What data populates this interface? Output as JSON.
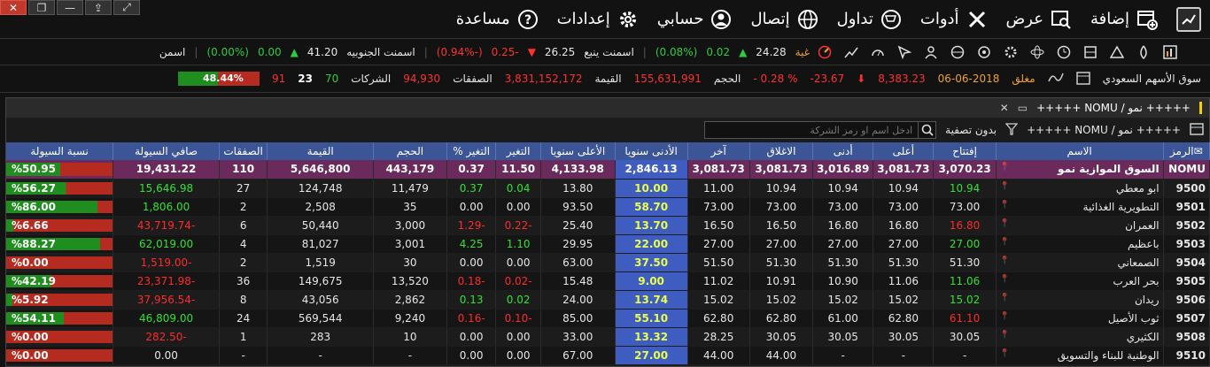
{
  "window_controls": {
    "close": "✕",
    "restore": "❐",
    "minimize": "—",
    "pin": "⇪",
    "expand": "⤢"
  },
  "menu": [
    {
      "label": "",
      "icon": "chart-icon"
    },
    {
      "label": "إضافة",
      "icon": "add-window-icon"
    },
    {
      "label": "عرض",
      "icon": "view-icon"
    },
    {
      "label": "أدوات",
      "icon": "tools-icon"
    },
    {
      "label": "تداول",
      "icon": "cart-icon"
    },
    {
      "label": "إتصال",
      "icon": "globe-icon"
    },
    {
      "label": "حسابي",
      "icon": "user-icon"
    },
    {
      "label": "إعدادات",
      "icon": "gear-icon"
    },
    {
      "label": "مساعدة",
      "icon": "help-icon"
    }
  ],
  "ticker": {
    "items": [
      {
        "name": "غية",
        "price": "24.28",
        "change": "0.02",
        "pct": "(0.08%)",
        "dir": "up"
      },
      {
        "name": "اسمنت ينبع",
        "price": "26.25",
        "change": "-0.25",
        "pct": "(-0.94%)",
        "dir": "down"
      },
      {
        "name": "اسمنت الجنوبيه",
        "price": "41.20",
        "change": "0.00",
        "pct": "(0.00%)",
        "dir": "up"
      },
      {
        "name": "اسمن",
        "price": "",
        "change": "",
        "pct": "",
        "dir": "up"
      }
    ]
  },
  "summary": {
    "market": "سوق الأسهم السعودي",
    "status": "مغلق",
    "date": "06-06-2018",
    "index": "8,383.23",
    "change": "23.67-",
    "pct": "% 0.28 -",
    "volume_label": "الحجم",
    "volume": "155,631,991",
    "value_label": "القيمة",
    "value": "3,831,152,172",
    "trades_label": "الصفقات",
    "trades": "94,930",
    "companies_label": "الشركات",
    "up": "70",
    "unchanged": "23",
    "down": "91",
    "ratio": "48.44%",
    "ratio_value": 48.44
  },
  "panel": {
    "title": "+++++ نمو / NOMU +++++",
    "toolbar_title": "+++++ نمو / NOMU +++++",
    "filter_label": "بدون تصفية",
    "search_placeholder": "ادخل اسم او رمز الشركة"
  },
  "table": {
    "headers": [
      "الرمز",
      "الاسم",
      "إفتتاح",
      "أعلى",
      "أدنى",
      "الاغلاق",
      "آخر",
      "الأدنى سنويا",
      "الأعلى سنويا",
      "التغير",
      "التغير %",
      "الحجم",
      "القيمة",
      "الصفقات",
      "صافي السيولة",
      "نسبة السيولة"
    ],
    "rows": [
      {
        "sym": "NOMU",
        "name": "السوق الموازية نمو",
        "open": "3,070.23",
        "high": "3,081.73",
        "low": "3,016.89",
        "close": "3,081.73",
        "last": "3,081.73",
        "ylow": "2,846.13",
        "yhigh": "4,133.98",
        "chg": "11.50",
        "chgp": "0.37",
        "vol": "443,179",
        "val": "5,646,800",
        "trades": "110",
        "net": "19,431.22",
        "liq": "%50.95",
        "liqv": 50.95,
        "hl": true,
        "dir": "up",
        "open_c": "",
        "last_c": ""
      },
      {
        "sym": "9500",
        "name": "ابو معطي",
        "open": "10.94",
        "high": "10.94",
        "low": "10.94",
        "close": "10.94",
        "last": "11.00",
        "ylow": "10.00",
        "yhigh": "13.80",
        "chg": "0.04",
        "chgp": "0.37",
        "vol": "11,479",
        "val": "124,748",
        "trades": "27",
        "net": "15,646.98",
        "liq": "%56.27",
        "liqv": 56.27,
        "dir": "up",
        "open_c": "g",
        "last_c": ""
      },
      {
        "sym": "9501",
        "name": "التطويرية الغذائية",
        "open": "73.00",
        "high": "73.00",
        "low": "73.00",
        "close": "73.00",
        "last": "73.00",
        "ylow": "58.70",
        "yhigh": "93.50",
        "chg": "0.00",
        "chgp": "0.00",
        "vol": "35",
        "val": "2,508",
        "trades": "2",
        "net": "1,806.00",
        "liq": "%86.00",
        "liqv": 86.0,
        "dir": "flat",
        "open_c": "",
        "last_c": ""
      },
      {
        "sym": "9502",
        "name": "العمران",
        "open": "16.80",
        "high": "16.80",
        "low": "16.80",
        "close": "16.50",
        "last": "16.50",
        "ylow": "13.70",
        "yhigh": "25.40",
        "chg": "-0.22",
        "chgp": "-1.29",
        "vol": "3,000",
        "val": "50,440",
        "trades": "6",
        "net": "-43,719.74",
        "liq": "%6.66",
        "liqv": 6.66,
        "dir": "down",
        "open_c": "rd",
        "last_c": ""
      },
      {
        "sym": "9503",
        "name": "باعظيم",
        "open": "27.00",
        "high": "27.00",
        "low": "27.00",
        "close": "27.00",
        "last": "27.00",
        "ylow": "22.00",
        "yhigh": "29.95",
        "chg": "1.10",
        "chgp": "4.25",
        "vol": "3,001",
        "val": "81,027",
        "trades": "4",
        "net": "62,019.00",
        "liq": "%88.27",
        "liqv": 88.27,
        "dir": "up",
        "open_c": "g",
        "last_c": ""
      },
      {
        "sym": "9504",
        "name": "الصمعاني",
        "open": "51.30",
        "high": "51.30",
        "low": "51.30",
        "close": "51.30",
        "last": "51.50",
        "ylow": "37.50",
        "yhigh": "63.00",
        "chg": "0.00",
        "chgp": "0.00",
        "vol": "30",
        "val": "1,519",
        "trades": "2",
        "net": "-1,519.00",
        "liq": "%0.00",
        "liqv": 0,
        "dir": "flat",
        "net_c": "rd",
        "open_c": "",
        "last_c": ""
      },
      {
        "sym": "9505",
        "name": "بحر العرب",
        "open": "11.06",
        "high": "11.06",
        "low": "10.90",
        "close": "10.91",
        "last": "11.02",
        "ylow": "9.00",
        "yhigh": "15.48",
        "chg": "-0.02",
        "chgp": "-0.18",
        "vol": "13,520",
        "val": "149,675",
        "trades": "36",
        "net": "-23,371.98",
        "liq": "%42.19",
        "liqv": 42.19,
        "dir": "down",
        "open_c": "g",
        "last_c": ""
      },
      {
        "sym": "9506",
        "name": "ريدان",
        "open": "15.02",
        "high": "15.02",
        "low": "15.02",
        "close": "15.02",
        "last": "15.02",
        "ylow": "13.74",
        "yhigh": "24.00",
        "chg": "0.02",
        "chgp": "0.13",
        "vol": "2,862",
        "val": "43,056",
        "trades": "8",
        "net": "-37,956.54",
        "liq": "%5.92",
        "liqv": 5.92,
        "dir": "up",
        "net_c": "rd",
        "open_c": "g",
        "last_c": ""
      },
      {
        "sym": "9507",
        "name": "ثوب الأصيل",
        "open": "61.10",
        "high": "62.80",
        "low": "61.00",
        "close": "62.80",
        "last": "62.80",
        "ylow": "55.10",
        "yhigh": "85.00",
        "chg": "-0.10",
        "chgp": "-0.16",
        "vol": "9,240",
        "val": "569,544",
        "trades": "24",
        "net": "46,809.00",
        "liq": "%54.11",
        "liqv": 54.11,
        "dir": "down",
        "net_c": "g",
        "open_c": "rd",
        "last_c": ""
      },
      {
        "sym": "9508",
        "name": "الكثيري",
        "open": "30.05",
        "high": "30.05",
        "low": "30.05",
        "close": "30.05",
        "last": "28.25",
        "ylow": "13.32",
        "yhigh": "33.00",
        "chg": "0.00",
        "chgp": "0.00",
        "vol": "10",
        "val": "283",
        "trades": "1",
        "net": "-282.50",
        "liq": "%0.00",
        "liqv": 0,
        "dir": "flat",
        "net_c": "rd",
        "open_c": "",
        "last_c": ""
      },
      {
        "sym": "9510",
        "name": "الوطنية للبناء والتسويق",
        "open": "-",
        "high": "-",
        "low": "-",
        "close": "44.00",
        "last": "44.00",
        "ylow": "27.00",
        "yhigh": "67.00",
        "chg": "0.00",
        "chgp": "0.00",
        "vol": "-",
        "val": "-",
        "trades": "-",
        "net": "0.00",
        "liq": "%0.00",
        "liqv": 0,
        "dir": "flat",
        "open_c": "",
        "last_c": ""
      }
    ]
  },
  "colors": {
    "accent_blue": "#3b5597",
    "up": "#2ecc40",
    "down": "#ff3030",
    "highlight": "#6a2a5c"
  }
}
